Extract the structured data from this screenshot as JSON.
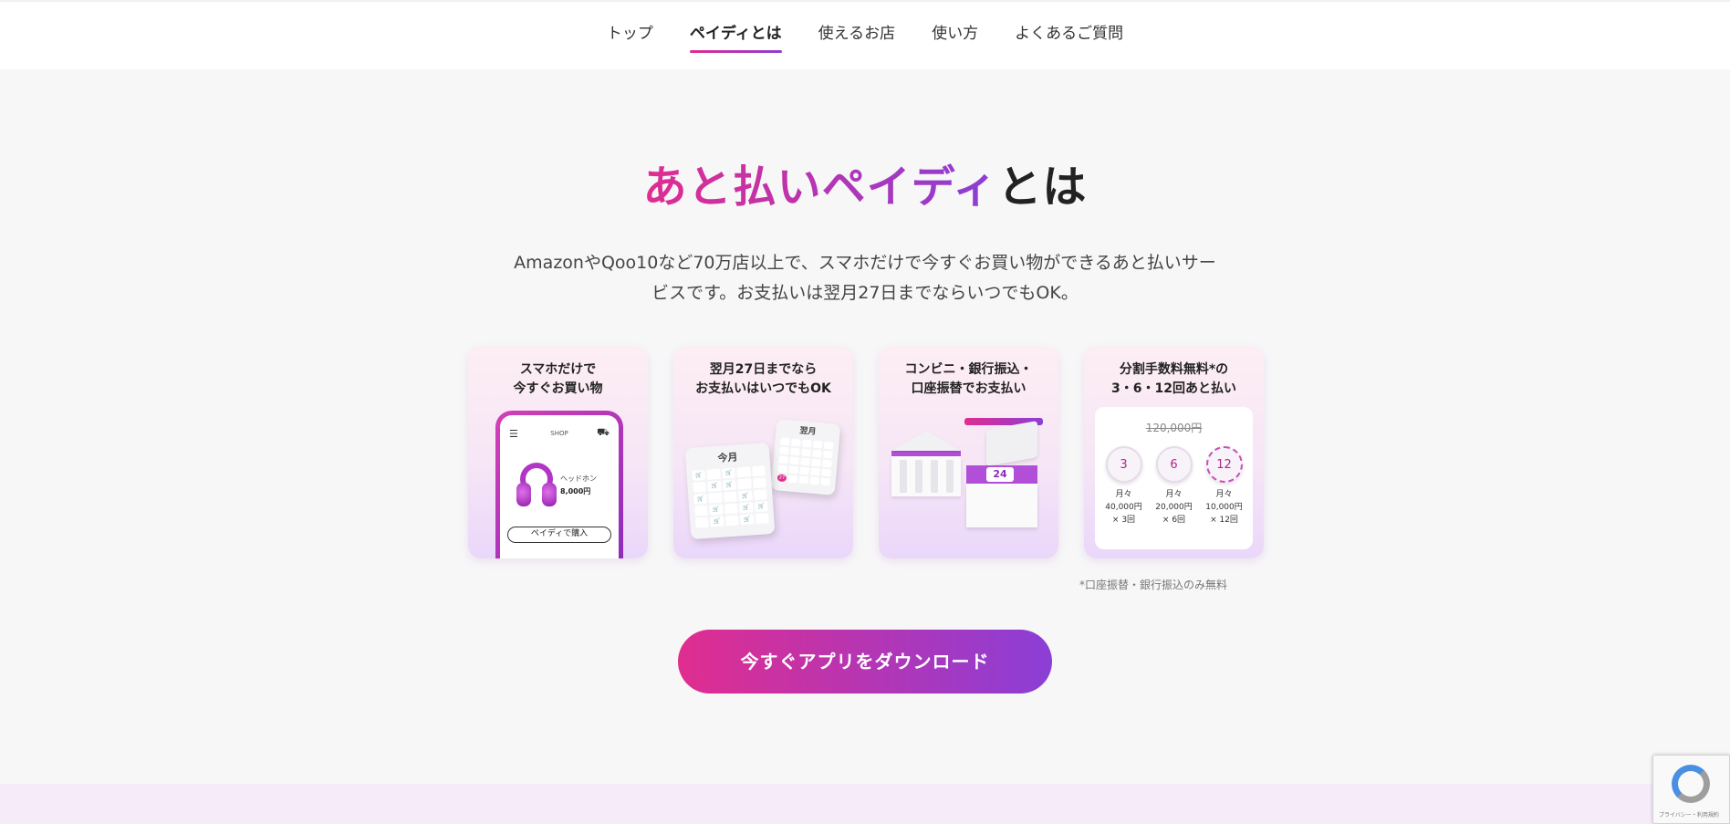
{
  "nav": {
    "items": [
      {
        "label": "トップ"
      },
      {
        "label": "ペイディとは"
      },
      {
        "label": "使えるお店"
      },
      {
        "label": "使い方"
      },
      {
        "label": "よくあるご質問"
      }
    ],
    "active_index": 1
  },
  "heading": {
    "highlight": "あと払いペイディ",
    "rest": "とは"
  },
  "description": {
    "line1": "AmazonやQoo10など70万店以上で、スマホだけで今すぐお買い物ができるあと払いサー",
    "line2": "ビスです。お支払いは翌月27日までならいつでもOK。"
  },
  "cards": [
    {
      "title_line1": "スマホだけで",
      "title_line2": "今すぐお買い物",
      "phone": {
        "shop_label": "SHOP",
        "product_name": "ヘッドホン",
        "product_price": "8,000円",
        "button_label": "ペイディで購入"
      }
    },
    {
      "title_line1": "翌月27日までなら",
      "title_line2": "お支払いはいつでもOK",
      "calendar": {
        "this_month": "今月",
        "next_month": "翌月",
        "highlight_day": "27"
      }
    },
    {
      "title_line1": "コンビニ・銀行振込・",
      "title_line2": "口座振替でお支払い",
      "store_number": "24"
    },
    {
      "title_line1": "分割手数料無料*の",
      "title_line2": "3・6・12回あと払い",
      "original_price": "120,000円",
      "installments": [
        {
          "count": "3",
          "monthly": "月々",
          "amount": "40,000円",
          "times": "× 3回"
        },
        {
          "count": "6",
          "monthly": "月々",
          "amount": "20,000円",
          "times": "× 6回"
        },
        {
          "count": "12",
          "monthly": "月々",
          "amount": "10,000円",
          "times": "× 12回"
        }
      ]
    }
  ],
  "note": "*口座振替・銀行振込のみ無料",
  "cta": {
    "label": "今すぐアプリをダウンロード"
  },
  "recaptcha": {
    "text": "プライバシー・利用規約"
  },
  "colors": {
    "gradient_start": "#e02d8f",
    "gradient_end": "#8b3ed6",
    "background": "#f7f7f8"
  }
}
